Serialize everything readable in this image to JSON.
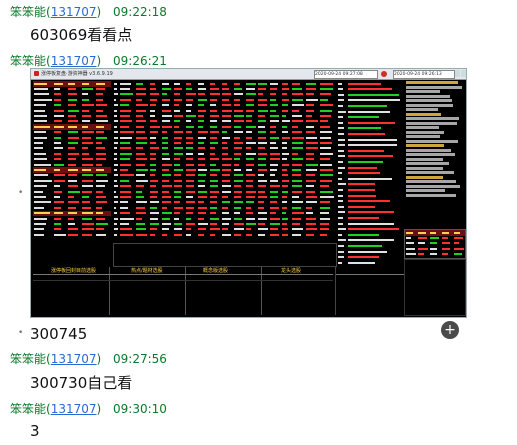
{
  "messages": [
    {
      "user": "笨笨能",
      "uid": "131707",
      "time": "09:22:18",
      "text": "603069看看点"
    },
    {
      "user": "笨笨能",
      "uid": "131707",
      "time": "09:26:21"
    },
    {
      "text": "300745"
    },
    {
      "user": "笨笨能",
      "uid": "131707",
      "time": "09:27:56",
      "text": "300730自己看"
    },
    {
      "user": "笨笨能",
      "uid": "131707",
      "time": "09:30:10",
      "text": "3"
    }
  ],
  "screenshot": {
    "title_text": "涨停板复盘·游资神器 v3.6.9.19",
    "clock_left": "2020-09-24 09:27:08",
    "clock_right": "2020-09-24 09:26:13",
    "bottom_panels": [
      "涨停板回封目前选股",
      "热点/题材选股",
      "概念版选股",
      "龙头选股"
    ],
    "colors": {
      "up": "#ff3030",
      "down": "#20d020",
      "header": "#6b1010",
      "accent": "#ffd04a"
    }
  },
  "fab": {
    "icon": "plus-icon",
    "label": "+"
  },
  "bullet": "•"
}
